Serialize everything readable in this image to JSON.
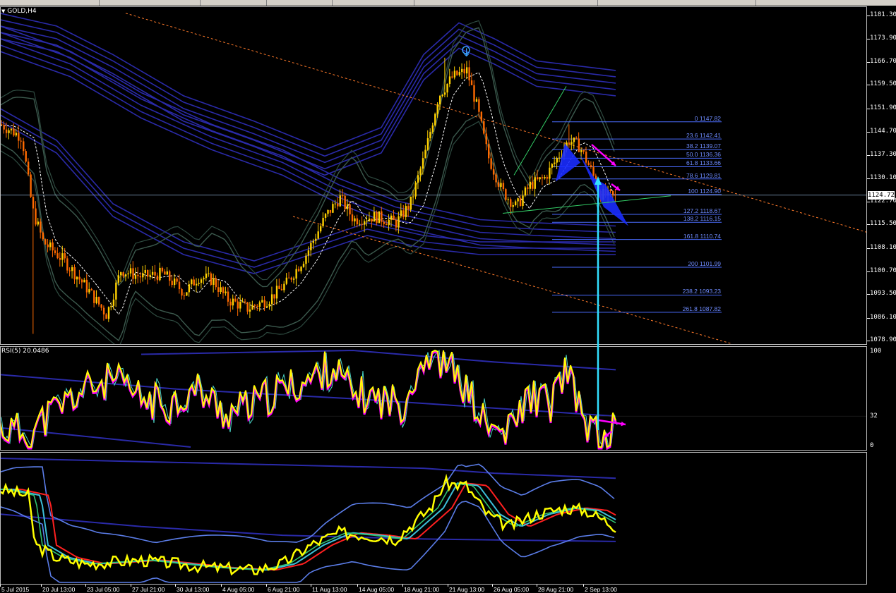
{
  "chart": {
    "symbol_title": "GOLD,H4",
    "current_price": "1124.72",
    "price_axis": [
      "1181.30",
      "1173.90",
      "1166.70",
      "1159.50",
      "1151.90",
      "1144.70",
      "1137.30",
      "1130.10",
      "1122.70",
      "1115.50",
      "1108.10",
      "1100.70",
      "1093.50",
      "1086.10",
      "1078.90"
    ],
    "fibonacci": [
      {
        "level": "0",
        "price": "1147.82"
      },
      {
        "level": "23.6",
        "price": "1142.41"
      },
      {
        "level": "38.2",
        "price": "1139.07"
      },
      {
        "level": "50.0",
        "price": "1136.36"
      },
      {
        "level": "61.8",
        "price": "1133.66"
      },
      {
        "level": "78.6",
        "price": "1129.81"
      },
      {
        "level": "100",
        "price": "1124.90"
      },
      {
        "level": "127.2",
        "price": "1118.67"
      },
      {
        "level": "138.2",
        "price": "1116.15"
      },
      {
        "level": "161.8",
        "price": "1110.74"
      },
      {
        "level": "200",
        "price": "1101.99"
      },
      {
        "level": "238.2",
        "price": "1093.23"
      },
      {
        "level": "261.8",
        "price": "1087.82"
      }
    ],
    "time_axis": [
      "5 Jul 2015",
      "20 Jul 13:00",
      "23 Jul 05:00",
      "27 Jul 21:00",
      "30 Jul 13:00",
      "4 Aug 05:00",
      "6 Aug 21:00",
      "11 Aug 13:00",
      "14 Aug 05:00",
      "18 Aug 21:00",
      "21 Aug 13:00",
      "26 Aug 05:00",
      "28 Aug 21:00",
      "2 Sep 13:00"
    ]
  },
  "rsi": {
    "title": "RSI(5) 20.0486",
    "axis": [
      "100",
      "32",
      "0"
    ]
  },
  "colors": {
    "bull_candle": "#ffd000",
    "bear_candle": "#ff6a00",
    "envelope": "#2a2aa8",
    "bollinger": "#3c5a4e",
    "fib": "#4a6cff",
    "channel": "#ff7a2a",
    "rsi_main": "#ffff00",
    "rsi_shadow": "#ff00ff",
    "cyan_arrow": "#33e0ff",
    "magenta_arrow": "#ff00ff",
    "pattern_fill": "#1a2cff"
  },
  "icons": {
    "pivot_arrow": "down-arrow-icon",
    "dropdown": "triangle-down-icon"
  }
}
